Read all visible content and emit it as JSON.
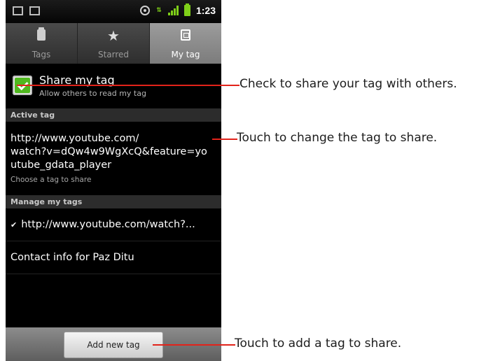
{
  "statusbar": {
    "time": "1:23"
  },
  "tabs": [
    {
      "label": "Tags",
      "icon": "tag-icon"
    },
    {
      "label": "Starred",
      "icon": "star-icon"
    },
    {
      "label": "My tag",
      "icon": "my-tag-icon"
    }
  ],
  "share": {
    "title": "Share my tag",
    "subtitle": "Allow others to read my tag",
    "checked": true
  },
  "active_tag": {
    "header": "Active tag",
    "lines": [
      "http://www.youtube.com/",
      "watch?v=dQw4w9WgXcQ&feature=yo",
      "utube_gdata_player"
    ],
    "hint": "Choose a tag to share"
  },
  "manage": {
    "header": "Manage my tags",
    "items": [
      {
        "label": "http://www.youtube.com/watch?...",
        "checked": true
      },
      {
        "label": "Contact info for Paz Ditu",
        "checked": false
      }
    ]
  },
  "add_button": "Add new tag",
  "callouts": [
    "Check to share your tag with others.",
    "Touch to change the tag to share.",
    "Touch to add a tag to share."
  ],
  "colors": {
    "accent_check": "#4fb81e",
    "callout_line": "#e2231a",
    "signal": "#7fcf19"
  }
}
